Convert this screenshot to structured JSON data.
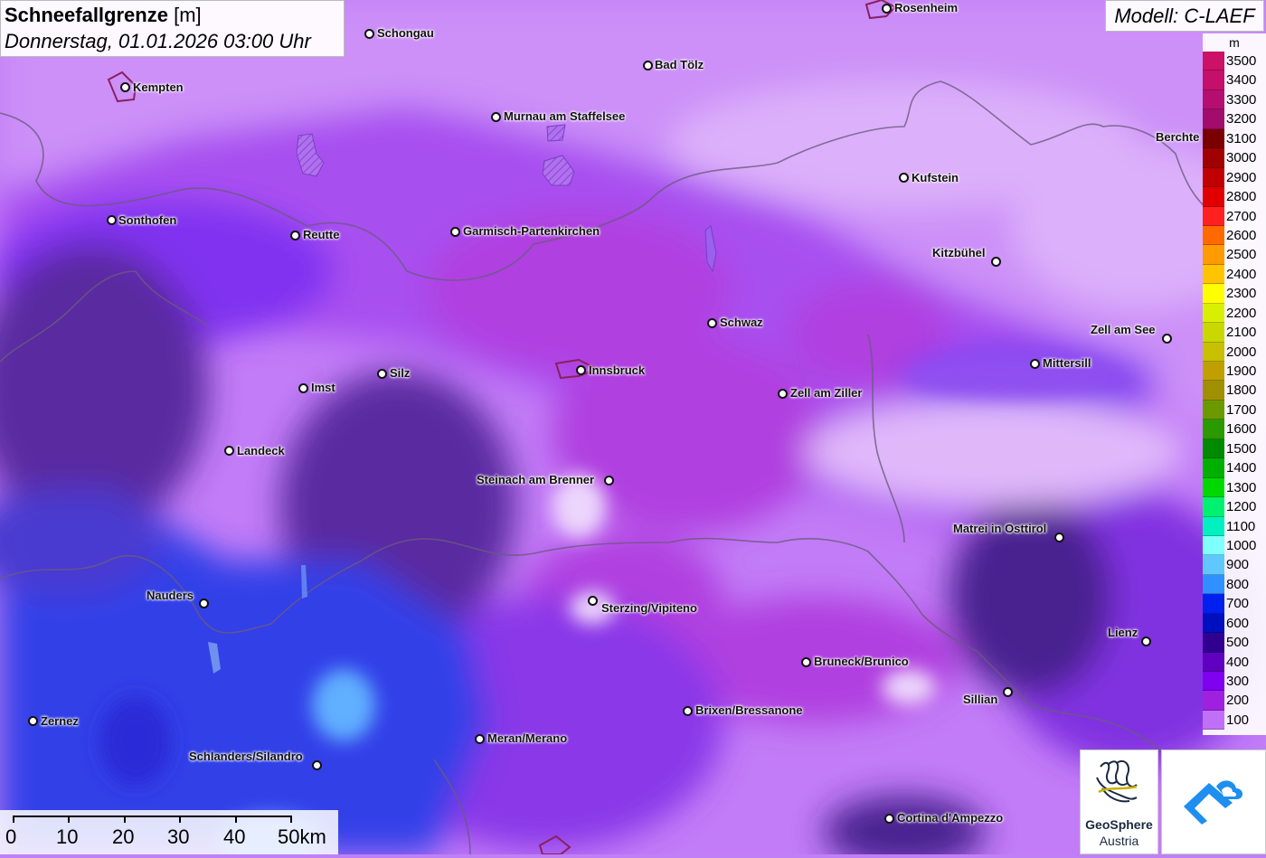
{
  "header": {
    "title": "Schneefallgrenze",
    "unit": "[m]",
    "datetime": "Donnerstag, 01.01.2026 03:00 Uhr"
  },
  "model": "Modell: C-LAEF",
  "legend": {
    "unit": "m",
    "levels": [
      {
        "label": "3500",
        "color": "#cc1166"
      },
      {
        "label": "3400",
        "color": "#c4106a"
      },
      {
        "label": "3300",
        "color": "#b60e70"
      },
      {
        "label": "3200",
        "color": "#a20c6c"
      },
      {
        "label": "3100",
        "color": "#7a0000"
      },
      {
        "label": "3000",
        "color": "#a00000"
      },
      {
        "label": "2900",
        "color": "#c00000"
      },
      {
        "label": "2800",
        "color": "#e00000"
      },
      {
        "label": "2700",
        "color": "#ff2020"
      },
      {
        "label": "2600",
        "color": "#ff6a00"
      },
      {
        "label": "2500",
        "color": "#ff9a00"
      },
      {
        "label": "2400",
        "color": "#ffc400"
      },
      {
        "label": "2300",
        "color": "#ffff00"
      },
      {
        "label": "2200",
        "color": "#d8f000"
      },
      {
        "label": "2100",
        "color": "#c8d800"
      },
      {
        "label": "2000",
        "color": "#c8c000"
      },
      {
        "label": "1900",
        "color": "#c0a000"
      },
      {
        "label": "1800",
        "color": "#a09000"
      },
      {
        "label": "1700",
        "color": "#6a9a00"
      },
      {
        "label": "1600",
        "color": "#2a9a00"
      },
      {
        "label": "1500",
        "color": "#008a00"
      },
      {
        "label": "1400",
        "color": "#00b000"
      },
      {
        "label": "1300",
        "color": "#00d800"
      },
      {
        "label": "1200",
        "color": "#00f070"
      },
      {
        "label": "1100",
        "color": "#00f0c0"
      },
      {
        "label": "1000",
        "color": "#80ffff"
      },
      {
        "label": "900",
        "color": "#60c8ff"
      },
      {
        "label": "800",
        "color": "#3090ff"
      },
      {
        "label": "700",
        "color": "#0020f0"
      },
      {
        "label": "600",
        "color": "#0010c0"
      },
      {
        "label": "500",
        "color": "#300090"
      },
      {
        "label": "400",
        "color": "#6000c0"
      },
      {
        "label": "300",
        "color": "#8000f0"
      },
      {
        "label": "200",
        "color": "#a020e0"
      },
      {
        "label": "100",
        "color": "#c070f8"
      }
    ]
  },
  "cities": [
    {
      "name": "Rosenheim"
    },
    {
      "name": "Schongau"
    },
    {
      "name": "Kempten"
    },
    {
      "name": "Bad Tölz"
    },
    {
      "name": "Murnau am Staffelsee"
    },
    {
      "name": "Berchte"
    },
    {
      "name": "Kufstein"
    },
    {
      "name": "Sonthofen"
    },
    {
      "name": "Reutte"
    },
    {
      "name": "Garmisch-Partenkirchen"
    },
    {
      "name": "Kitzbühel"
    },
    {
      "name": "Schwaz"
    },
    {
      "name": "Zell am See"
    },
    {
      "name": "Innsbruck"
    },
    {
      "name": "Silz"
    },
    {
      "name": "Mittersill"
    },
    {
      "name": "Imst"
    },
    {
      "name": "Zell am Ziller"
    },
    {
      "name": "Landeck"
    },
    {
      "name": "Steinach am Brenner"
    },
    {
      "name": "Matrei in Osttirol"
    },
    {
      "name": "Nauders"
    },
    {
      "name": "Sterzing/Vipiteno"
    },
    {
      "name": "Lienz"
    },
    {
      "name": "Bruneck/Brunico"
    },
    {
      "name": "Sillian"
    },
    {
      "name": "Brixen/Bressanone"
    },
    {
      "name": "Zernez"
    },
    {
      "name": "Meran/Merano"
    },
    {
      "name": "Schlanders/Silandro"
    },
    {
      "name": "Cortina d'Ampezzo"
    }
  ],
  "scale": {
    "labels": [
      "0",
      "10",
      "20",
      "30",
      "40",
      "50km"
    ]
  },
  "logos": {
    "geosphere_name": "GeoSphere",
    "geosphere_sub": "Austria"
  }
}
